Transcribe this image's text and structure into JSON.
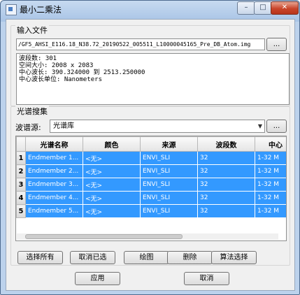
{
  "window": {
    "title": "最小二乘法",
    "min_glyph": "–",
    "max_glyph": "□",
    "close_glyph": "✕"
  },
  "input_file": {
    "group_title": "输入文件",
    "path": "/GF5_AHSI_E116.18_N38.72_20190522_005511_L10000045165_Pre_DB_Atom.img",
    "browse_label": "...",
    "info_lines": [
      "波段数: 301",
      "空间大小: 2008 x 2083",
      "中心波长: 390.324000 到 2513.250000",
      "中心波长单位: Nanometers"
    ]
  },
  "spectral": {
    "group_title": "光谱搜集",
    "source_label": "波谱源:",
    "source_value": "光谱库",
    "browse_label": "...",
    "columns": [
      "光谱名称",
      "颜色",
      "来源",
      "波段数",
      "中心"
    ],
    "rows": [
      {
        "index": "1",
        "name": "Endmember 1...",
        "color": "<无>",
        "source": "ENVI_SLI",
        "bands": "32",
        "range": "1-32 M"
      },
      {
        "index": "2",
        "name": "Endmember 2...",
        "color": "<无>",
        "source": "ENVI_SLI",
        "bands": "32",
        "range": "1-32 M"
      },
      {
        "index": "3",
        "name": "Endmember 3...",
        "color": "<无>",
        "source": "ENVI_SLI",
        "bands": "32",
        "range": "1-32 M"
      },
      {
        "index": "4",
        "name": "Endmember 4...",
        "color": "<无>",
        "source": "ENVI_SLI",
        "bands": "32",
        "range": "1-32 M"
      },
      {
        "index": "5",
        "name": "Endmember 5...",
        "color": "<无>",
        "source": "ENVI_SLI",
        "bands": "32",
        "range": "1-32 M"
      }
    ],
    "actions": {
      "select_all": "选择所有",
      "deselect": "取消已选",
      "plot": "绘图",
      "delete": "删除",
      "algorithm": "算法选择"
    }
  },
  "footer": {
    "apply": "应用",
    "cancel": "取消"
  }
}
